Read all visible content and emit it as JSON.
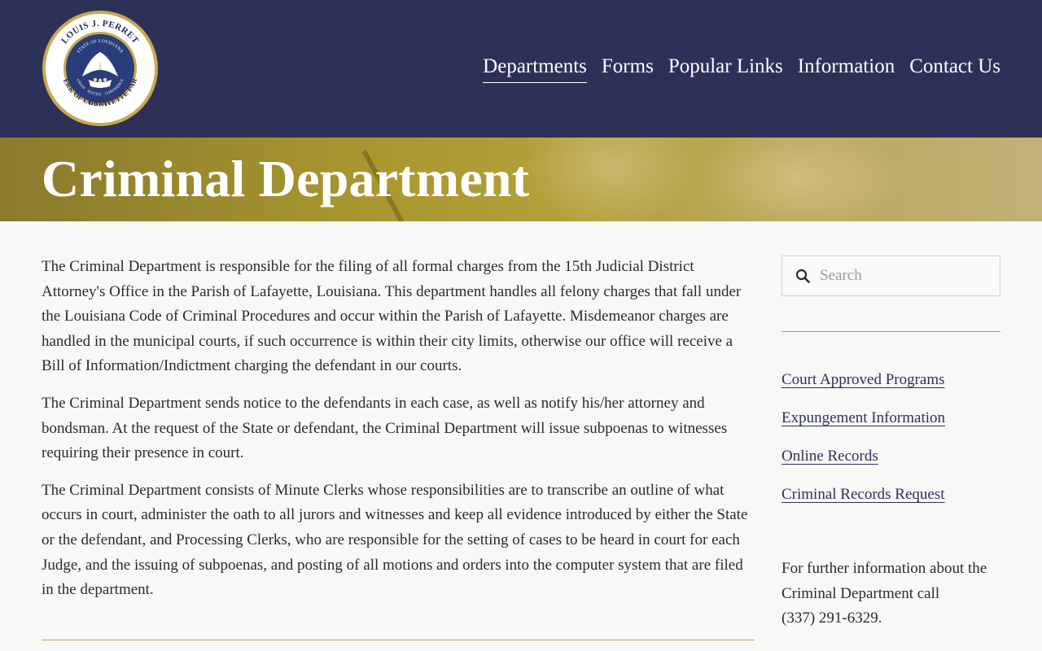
{
  "header": {
    "logo": {
      "ring_top_text": "LOUIS J. PERRET",
      "ring_left_text": "CLERK OF COURT",
      "ring_right_text": "LAFAYETTE PARISH",
      "seal_top_text": "STATE OF LOUISIANA",
      "seal_bottom_text": "UNION · JUSTICE · CONFIDENCE"
    },
    "nav": [
      {
        "label": "Departments",
        "active": true
      },
      {
        "label": "Forms",
        "active": false
      },
      {
        "label": "Popular Links",
        "active": false
      },
      {
        "label": "Information",
        "active": false
      },
      {
        "label": "Contact Us",
        "active": false
      }
    ]
  },
  "banner": {
    "title": "Criminal Department"
  },
  "main": {
    "paragraphs": [
      "The Criminal Department is responsible for the filing of all formal charges from the 15th Judicial District Attorney's Office in the Parish of Lafayette, Louisiana. This department handles all felony charges that fall under the Louisiana Code of Criminal Procedures and occur within the Parish of Lafayette. Misdemeanor charges are handled in the municipal courts, if such occurrence is within their city limits, otherwise our office will receive a Bill of Information/Indictment charging the defendant in our courts.",
      "The Criminal Department sends notice to the defendants in each case, as well as notify his/her attorney and bondsman. At the request of the State or defendant, the Criminal Department will issue subpoenas to witnesses requiring their presence in court.",
      "The Criminal Department consists of Minute Clerks whose responsibilities are to transcribe an outline of what occurs in court, administer the oath to all jurors and witnesses and keep all evidence introduced by either the State or the defendant, and Processing Clerks, who are responsible for the setting of cases to be heard in court for each Judge, and the issuing of subpoenas, and posting of all motions and orders into the computer system that are filed in the department."
    ]
  },
  "sidebar": {
    "search": {
      "placeholder": "Search",
      "value": "",
      "icon": "search-icon"
    },
    "links": [
      "Court Approved Programs",
      "Expungement Information",
      "Online Records",
      "Criminal Records Request"
    ],
    "info_line1": "For further information about the",
    "info_line2": "Criminal Department call",
    "info_phone": "(337) 291-6329."
  },
  "colors": {
    "header_bg": "#2d3157",
    "banner_gold": "#a8962f",
    "accent_rule": "#b9a04a",
    "link": "#2d3157",
    "page_bg": "#f8f8f7"
  }
}
